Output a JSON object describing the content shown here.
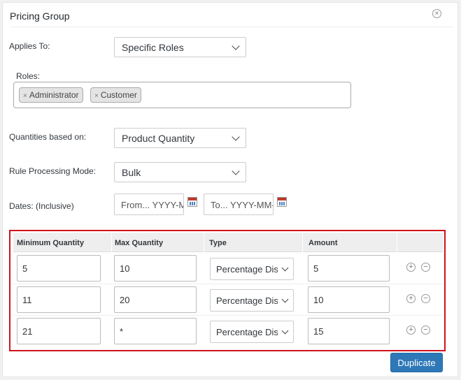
{
  "panel": {
    "title": "Pricing Group",
    "close_icon": "close-icon"
  },
  "applies_to": {
    "label": "Applies To:",
    "value": "Specific Roles"
  },
  "roles": {
    "label": "Roles:",
    "tags": [
      "Administrator",
      "Customer"
    ],
    "remove_glyph": "×"
  },
  "quantities_based_on": {
    "label": "Quantities based on:",
    "value": "Product Quantity"
  },
  "rule_processing_mode": {
    "label": "Rule Processing Mode:",
    "value": "Bulk"
  },
  "dates": {
    "label": "Dates: (Inclusive)",
    "from_placeholder": "From... YYYY-MM-DD",
    "to_placeholder": "To... YYYY-MM-DD",
    "calendar_icon": "calendar-icon"
  },
  "quantity_table": {
    "headers": [
      "Minimum Quantity",
      "Max Quantity",
      "Type",
      "Amount"
    ],
    "rows": [
      {
        "min": "5",
        "max": "10",
        "type": "Percentage Discount",
        "amount": "5"
      },
      {
        "min": "11",
        "max": "20",
        "type": "Percentage Discount",
        "amount": "10"
      },
      {
        "min": "21",
        "max": "*",
        "type": "Percentage Discount",
        "amount": "15"
      }
    ],
    "add_glyph": "+",
    "remove_glyph": "−"
  },
  "duplicate_button": {
    "label": "Duplicate"
  },
  "colors": {
    "highlight_border": "#d0121b",
    "primary_button": "#2e78b7"
  }
}
